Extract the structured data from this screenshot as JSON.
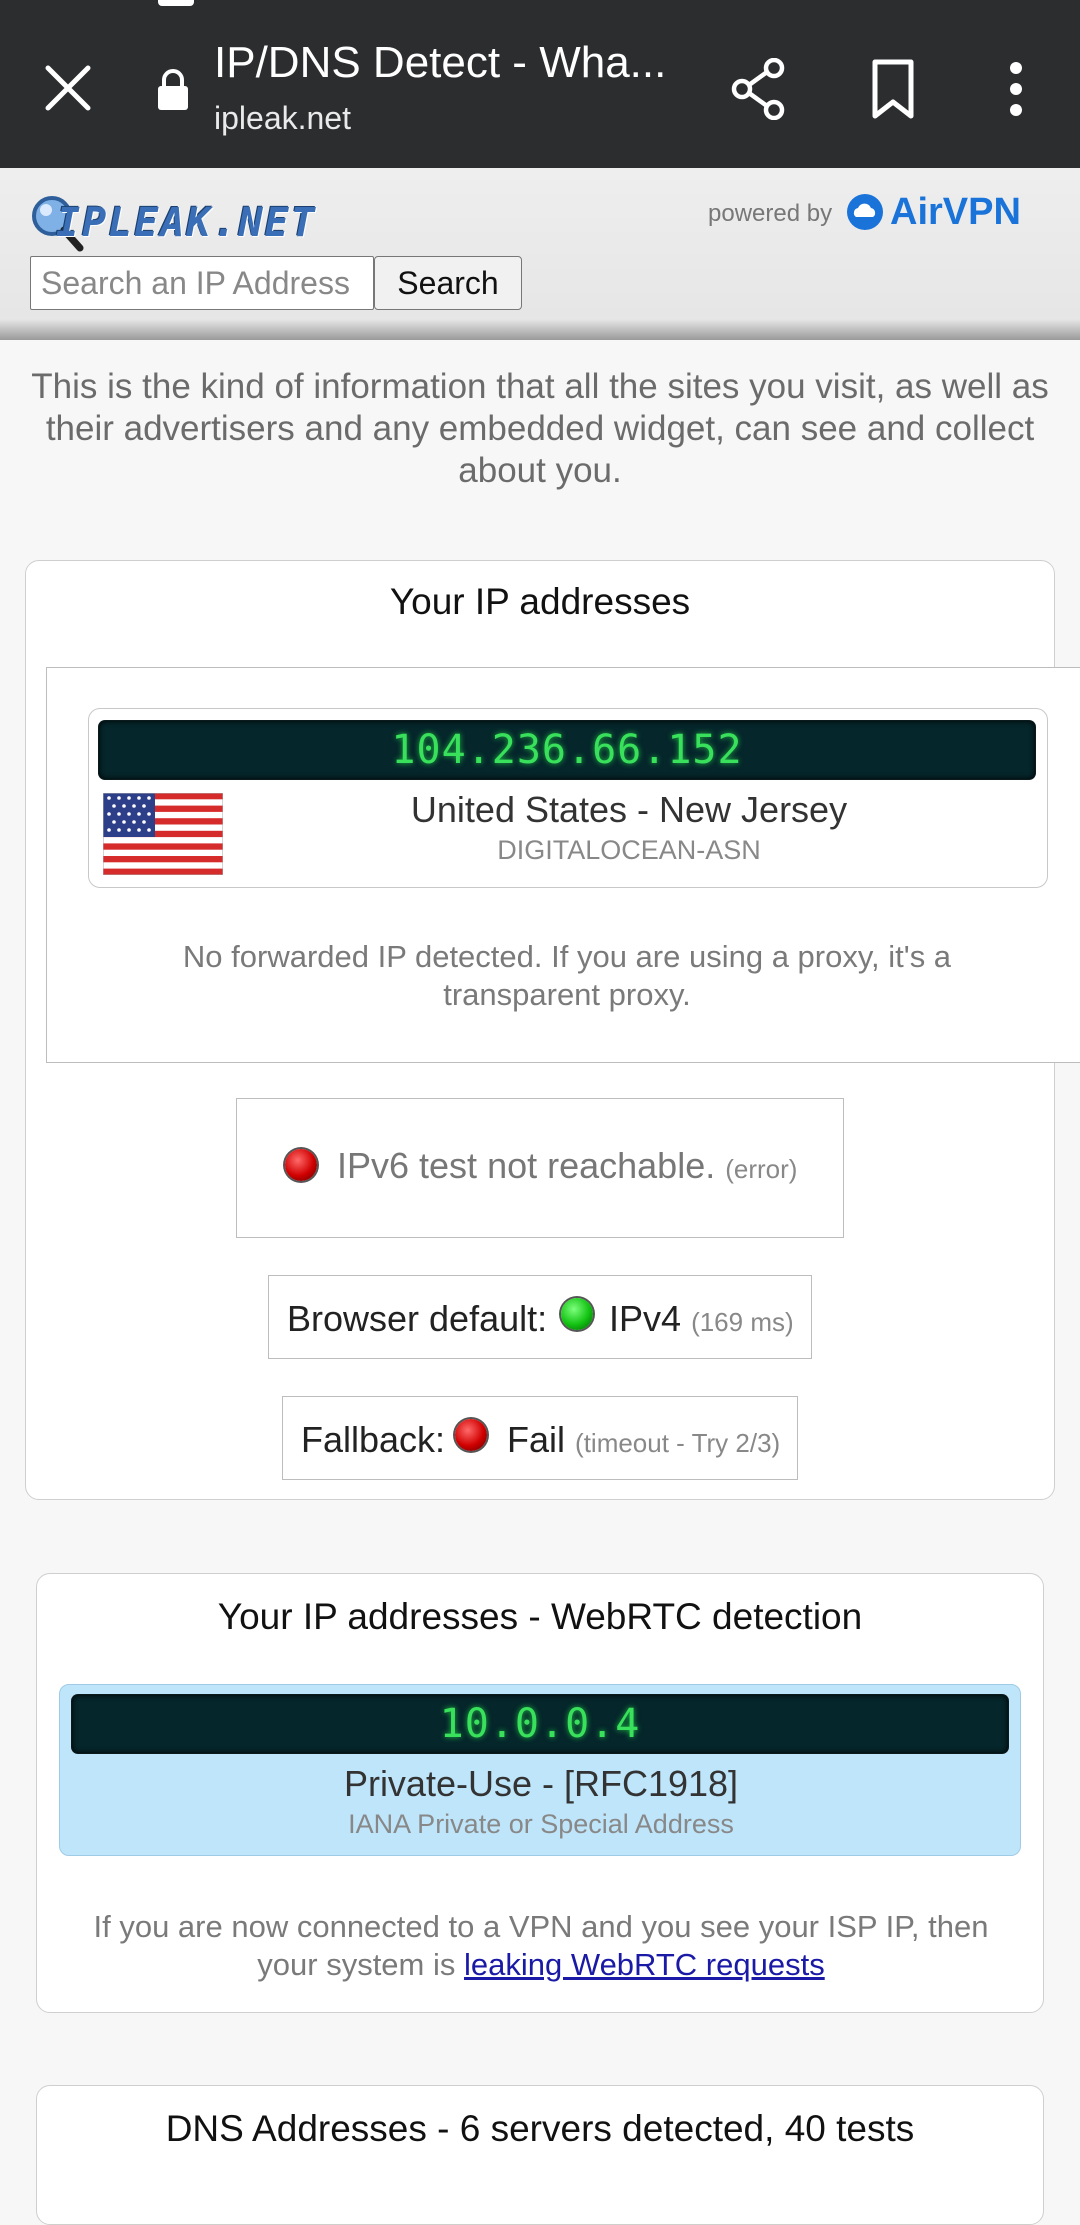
{
  "browser": {
    "title": "IP/DNS Detect - Wha...",
    "url": "ipleak.net",
    "icons": [
      "close-icon",
      "lock-icon",
      "share-icon",
      "bookmark-icon",
      "more-vert-icon"
    ]
  },
  "header": {
    "logo_text": "IPLEAK.NET",
    "powered_by": "powered by",
    "brand": "AirVPN",
    "search_placeholder": "Search an IP Address",
    "search_button": "Search"
  },
  "intro": "This is the kind of information that all the sites you visit, as well as their advertisers and any embedded widget, can see and collect about you.",
  "ip_section": {
    "title": "Your IP addresses",
    "ip": "104.236.66.152",
    "location": "United States - New Jersey",
    "asn": "DIGITALOCEAN-ASN",
    "forward_note": "No forwarded IP detected. If you are using a proxy, it's a transparent proxy.",
    "ipv6": {
      "text": "IPv6 test not reachable.",
      "detail": "(error)",
      "status": "red"
    },
    "browser_default": {
      "label": "Browser default:",
      "value": "IPv4",
      "detail": "(169 ms)",
      "status": "green"
    },
    "fallback": {
      "label": "Fallback:",
      "value": "Fail",
      "detail": "(timeout - Try 2/3)",
      "status": "red"
    }
  },
  "webrtc_section": {
    "title": "Your IP addresses - WebRTC detection",
    "ip": "10.0.0.4",
    "label": "Private-Use - [RFC1918]",
    "sublabel": "IANA Private or Special Address",
    "note_prefix": "If you are now connected to a VPN and you see your ISP IP, then your system is",
    "note_link": "leaking WebRTC requests"
  },
  "dns_section": {
    "title": "DNS Addresses - 6 servers detected, 40 tests"
  },
  "colors": {
    "chrome_bg": "#2b2d2f",
    "ip_text": "#39e05b",
    "ip_banner_bg": "#05262b",
    "brand_blue": "#1a73d9",
    "webrtc_bg": "#bfe5fa"
  }
}
